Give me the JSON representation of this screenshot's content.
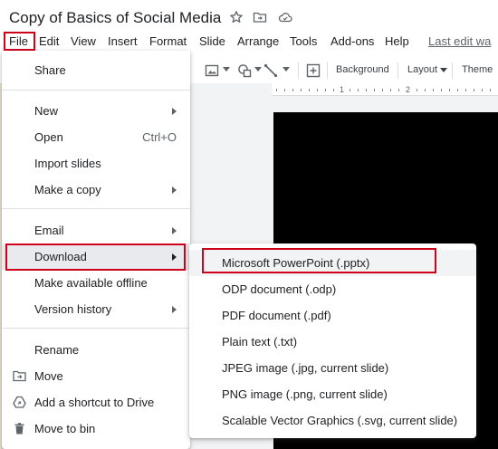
{
  "document": {
    "title": "Copy of Basics of Social Media"
  },
  "menubar": {
    "items": [
      "File",
      "Edit",
      "View",
      "Insert",
      "Format",
      "Slide",
      "Arrange",
      "Tools",
      "Add-ons",
      "Help"
    ],
    "last_edit": "Last edit wa"
  },
  "toolbar": {
    "background_label": "Background",
    "layout_label": "Layout",
    "theme_label": "Theme"
  },
  "ruler": {
    "labels": [
      "1",
      "2"
    ]
  },
  "file_menu": {
    "share": "Share",
    "new": "New",
    "open": "Open",
    "open_shortcut": "Ctrl+O",
    "import_slides": "Import slides",
    "make_copy": "Make a copy",
    "email": "Email",
    "download": "Download",
    "make_offline": "Make available offline",
    "version_history": "Version history",
    "rename": "Rename",
    "move": "Move",
    "add_shortcut": "Add a shortcut to Drive",
    "move_to_bin": "Move to bin"
  },
  "download_menu": {
    "items": [
      "Microsoft PowerPoint (.pptx)",
      "ODP document (.odp)",
      "PDF document (.pdf)",
      "Plain text (.txt)",
      "JPEG image (.jpg, current slide)",
      "PNG image (.png, current slide)",
      "Scalable Vector Graphics (.svg, current slide)"
    ]
  },
  "colors": {
    "highlight_border": "#d0021b",
    "menu_hover": "#e8eaed",
    "slide_background": "#000000"
  },
  "icons": {
    "star": "star-icon",
    "move_folder": "folder-move-icon",
    "cloud": "cloud-saved-icon",
    "image": "image-icon",
    "shape": "shape-icon",
    "line": "line-icon",
    "comment": "add-comment-icon",
    "move": "folder-move-icon",
    "shortcut": "drive-shortcut-icon",
    "bin": "bin-icon"
  }
}
